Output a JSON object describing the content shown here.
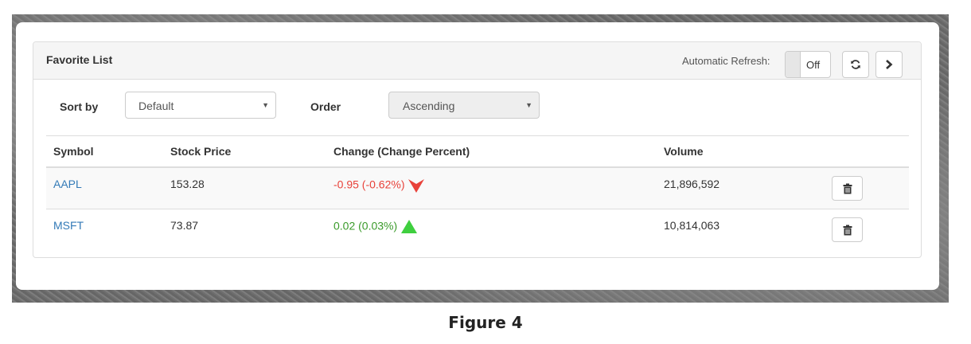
{
  "panel": {
    "title": "Favorite List",
    "refresh_label": "Automatic Refresh:",
    "toggle_state": "Off",
    "refresh_icon": "refresh-icon",
    "next_icon": "chevron-right-icon"
  },
  "controls": {
    "sort_label": "Sort by",
    "sort_value": "Default",
    "order_label": "Order",
    "order_value": "Ascending"
  },
  "table": {
    "headers": [
      "Symbol",
      "Stock Price",
      "Change (Change Percent)",
      "Volume"
    ],
    "rows": [
      {
        "symbol": "AAPL",
        "price": "153.28",
        "change": "-0.95 (-0.62%)",
        "direction": "down",
        "volume": "21,896,592"
      },
      {
        "symbol": "MSFT",
        "price": "73.87",
        "change": "0.02 (0.03%)",
        "direction": "up",
        "volume": "10,814,063"
      }
    ]
  },
  "colors": {
    "link": "#337ab7",
    "negative": "#e8423a",
    "positive": "#3a9a2a"
  },
  "caption": "Figure 4"
}
